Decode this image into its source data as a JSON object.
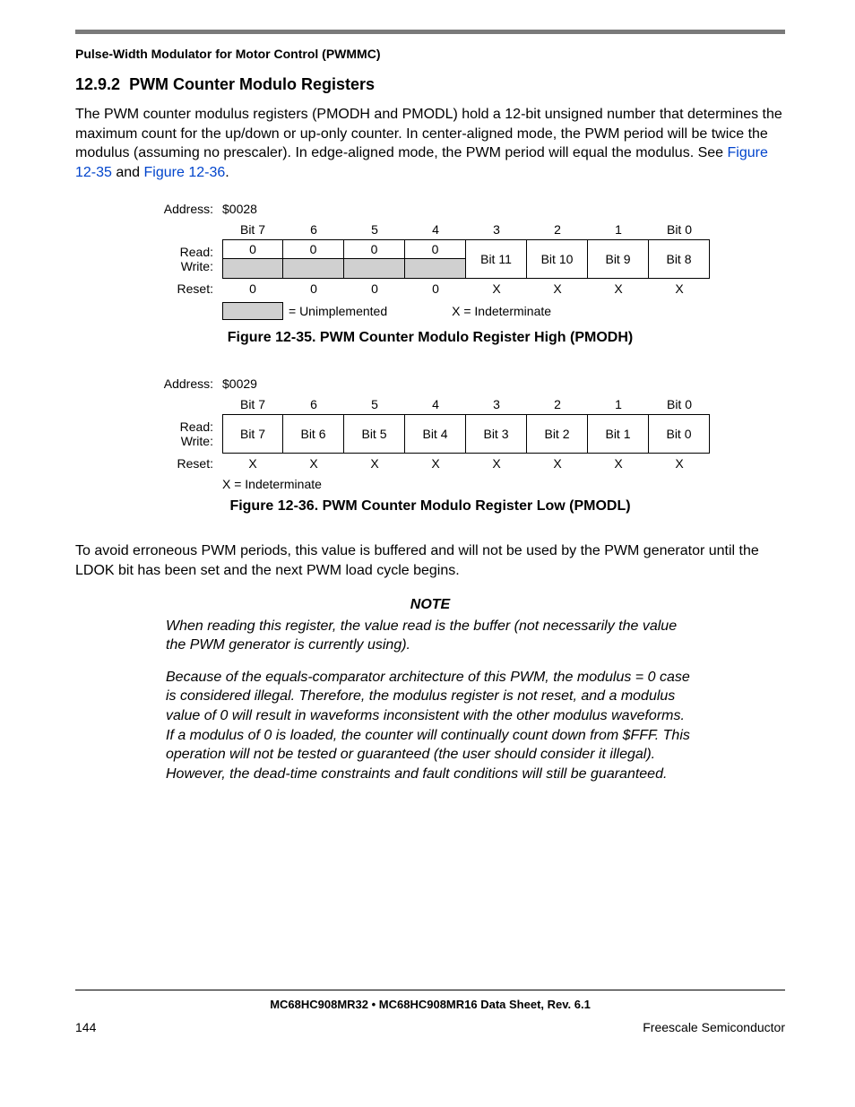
{
  "chapter": "Pulse-Width Modulator for Motor Control (PWMMC)",
  "section_num": "12.9.2",
  "section_title": "PWM Counter Modulo Registers",
  "para1a": "The PWM counter modulus registers (PMODH and PMODL) hold a 12-bit unsigned number that determines the maximum count for the up/down or up-only counter. In center-aligned mode, the PWM period will be twice the modulus (assuming no prescaler). In edge-aligned mode, the PWM period will equal the modulus. See ",
  "ref1": "Figure 12-35",
  "para1b": " and ",
  "ref2": "Figure 12-36",
  "para1c": ".",
  "labels": {
    "address": "Address:",
    "read": "Read:",
    "write": "Write:",
    "reset": "Reset:",
    "unimp": "= Unimplemented",
    "indet": "X = Indeterminate"
  },
  "fig35": {
    "caption": "Figure 12-35. PWM Counter Modulo Register High (PMODH)",
    "address": "$0028",
    "headers": [
      "Bit 7",
      "6",
      "5",
      "4",
      "3",
      "2",
      "1",
      "Bit 0"
    ],
    "read": [
      "0",
      "0",
      "0",
      "0",
      "Bit 11",
      "Bit 10",
      "Bit 9",
      "Bit 8"
    ],
    "reset": [
      "0",
      "0",
      "0",
      "0",
      "X",
      "X",
      "X",
      "X"
    ]
  },
  "fig36": {
    "caption": "Figure 12-36. PWM Counter Modulo Register Low (PMODL)",
    "address": "$0029",
    "headers": [
      "Bit 7",
      "6",
      "5",
      "4",
      "3",
      "2",
      "1",
      "Bit 0"
    ],
    "rw": [
      "Bit 7",
      "Bit 6",
      "Bit 5",
      "Bit 4",
      "Bit 3",
      "Bit 2",
      "Bit 1",
      "Bit 0"
    ],
    "reset": [
      "X",
      "X",
      "X",
      "X",
      "X",
      "X",
      "X",
      "X"
    ]
  },
  "para2": "To avoid erroneous PWM periods, this value is buffered and will not be used by the PWM generator until the LDOK bit has been set and the next PWM load cycle begins.",
  "note_title": "NOTE",
  "note1": "When reading this register, the value read is the buffer (not necessarily the value the PWM generator is currently using).",
  "note2": "Because of the equals-comparator architecture of this PWM, the modulus = 0 case is considered illegal. Therefore, the modulus register is not reset, and a modulus value of 0 will result in waveforms inconsistent with the other modulus waveforms. If a modulus of 0 is loaded, the counter will continually count down from $FFF. This operation will not be tested or guaranteed (the user should consider it illegal). However, the dead-time constraints and fault conditions will still be guaranteed.",
  "footer_center": "MC68HC908MR32 • MC68HC908MR16 Data Sheet, Rev. 6.1",
  "page_num": "144",
  "vendor": "Freescale Semiconductor"
}
